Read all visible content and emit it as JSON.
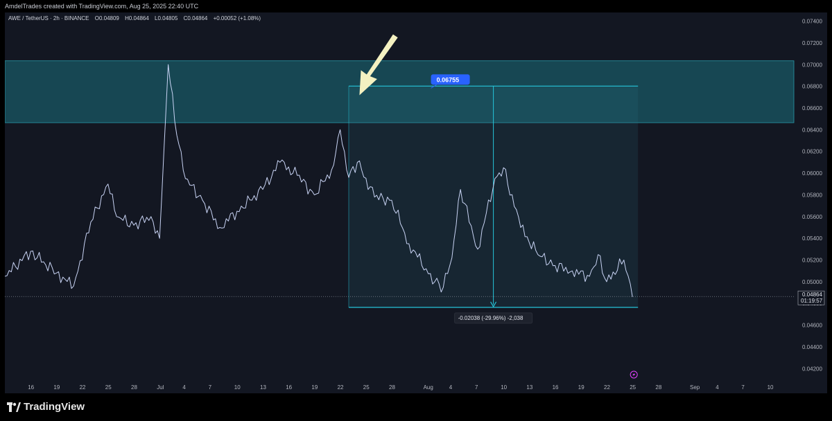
{
  "header": {
    "caption": "AmdelTrades created with TradingView.com, Aug 25, 2025 22:40 UTC"
  },
  "symbol_bar": {
    "pair": "AWE / TetherUS · 2h · BINANCE",
    "open": "O0.04809",
    "high": "H0.04864",
    "low": "L0.04805",
    "close": "C0.04864",
    "change": "+0.00052 (+1.08%)"
  },
  "brand": {
    "name": "TradingView"
  },
  "colors": {
    "background": "#131722",
    "price_line": "#c9d4f5",
    "zone_fill": "#1c6f7c",
    "measure_line": "#26c6da",
    "label_blue": "#2962ff",
    "arrow": "#f4f1c1"
  },
  "chart_data": {
    "type": "line",
    "symbol": "AWE / TetherUS",
    "interval": "2h",
    "exchange": "BINANCE",
    "y_axis": {
      "min": 0.041,
      "max": 0.0748,
      "ticks": [
        "0.04200",
        "0.04400",
        "0.04600",
        "0.04800",
        "0.05000",
        "0.05200",
        "0.05400",
        "0.05600",
        "0.05800",
        "0.06000",
        "0.06200",
        "0.06400",
        "0.06600",
        "0.06800",
        "0.07000",
        "0.07200",
        "0.07400"
      ]
    },
    "x_axis": {
      "ticks": [
        "16",
        "19",
        "22",
        "25",
        "28",
        "Jul",
        "4",
        "7",
        "10",
        "13",
        "16",
        "19",
        "22",
        "25",
        "28",
        "Aug",
        "4",
        "7",
        "10",
        "13",
        "16",
        "19",
        "22",
        "25",
        "28",
        "Sep",
        "4",
        "7",
        "10"
      ]
    },
    "series": [
      {
        "x": [
          "2025-06-13",
          "2025-06-16",
          "2025-06-19",
          "2025-06-21",
          "2025-06-23",
          "2025-06-25",
          "2025-06-26",
          "2025-06-28",
          "2025-06-30",
          "2025-07-01",
          "2025-07-02",
          "2025-07-03",
          "2025-07-04",
          "2025-07-06",
          "2025-07-08",
          "2025-07-10",
          "2025-07-13",
          "2025-07-15",
          "2025-07-17",
          "2025-07-19",
          "2025-07-21",
          "2025-07-22",
          "2025-07-23",
          "2025-07-24",
          "2025-07-26",
          "2025-07-28",
          "2025-07-30",
          "2025-08-01",
          "2025-08-02",
          "2025-08-03",
          "2025-08-04",
          "2025-08-05",
          "2025-08-07",
          "2025-08-09",
          "2025-08-10",
          "2025-08-12",
          "2025-08-14",
          "2025-08-16",
          "2025-08-18",
          "2025-08-20",
          "2025-08-21",
          "2025-08-22",
          "2025-08-24",
          "2025-08-25"
        ],
        "y": [
          0.0505,
          0.0528,
          0.0508,
          0.0496,
          0.0555,
          0.059,
          0.056,
          0.0552,
          0.056,
          0.054,
          0.07,
          0.0635,
          0.0595,
          0.0575,
          0.055,
          0.0565,
          0.0585,
          0.061,
          0.0598,
          0.058,
          0.0603,
          0.064,
          0.0596,
          0.061,
          0.0578,
          0.0575,
          0.0535,
          0.0512,
          0.05,
          0.0495,
          0.0522,
          0.0585,
          0.053,
          0.0595,
          0.0605,
          0.055,
          0.0525,
          0.0515,
          0.051,
          0.0505,
          0.0525,
          0.05,
          0.052,
          0.0486
        ]
      }
    ],
    "resistance_zone": {
      "from": 0.06465,
      "to": 0.07035
    },
    "measure": {
      "start_date": "2025-07-23",
      "end_date": "2025-08-25",
      "high": 0.06802,
      "low": 0.04764,
      "target_label": "0.06755",
      "change_label": "-0.02038 (-29.96%) -2,038"
    },
    "last_price": {
      "value": "0.04864",
      "countdown": "01:19:57"
    }
  }
}
